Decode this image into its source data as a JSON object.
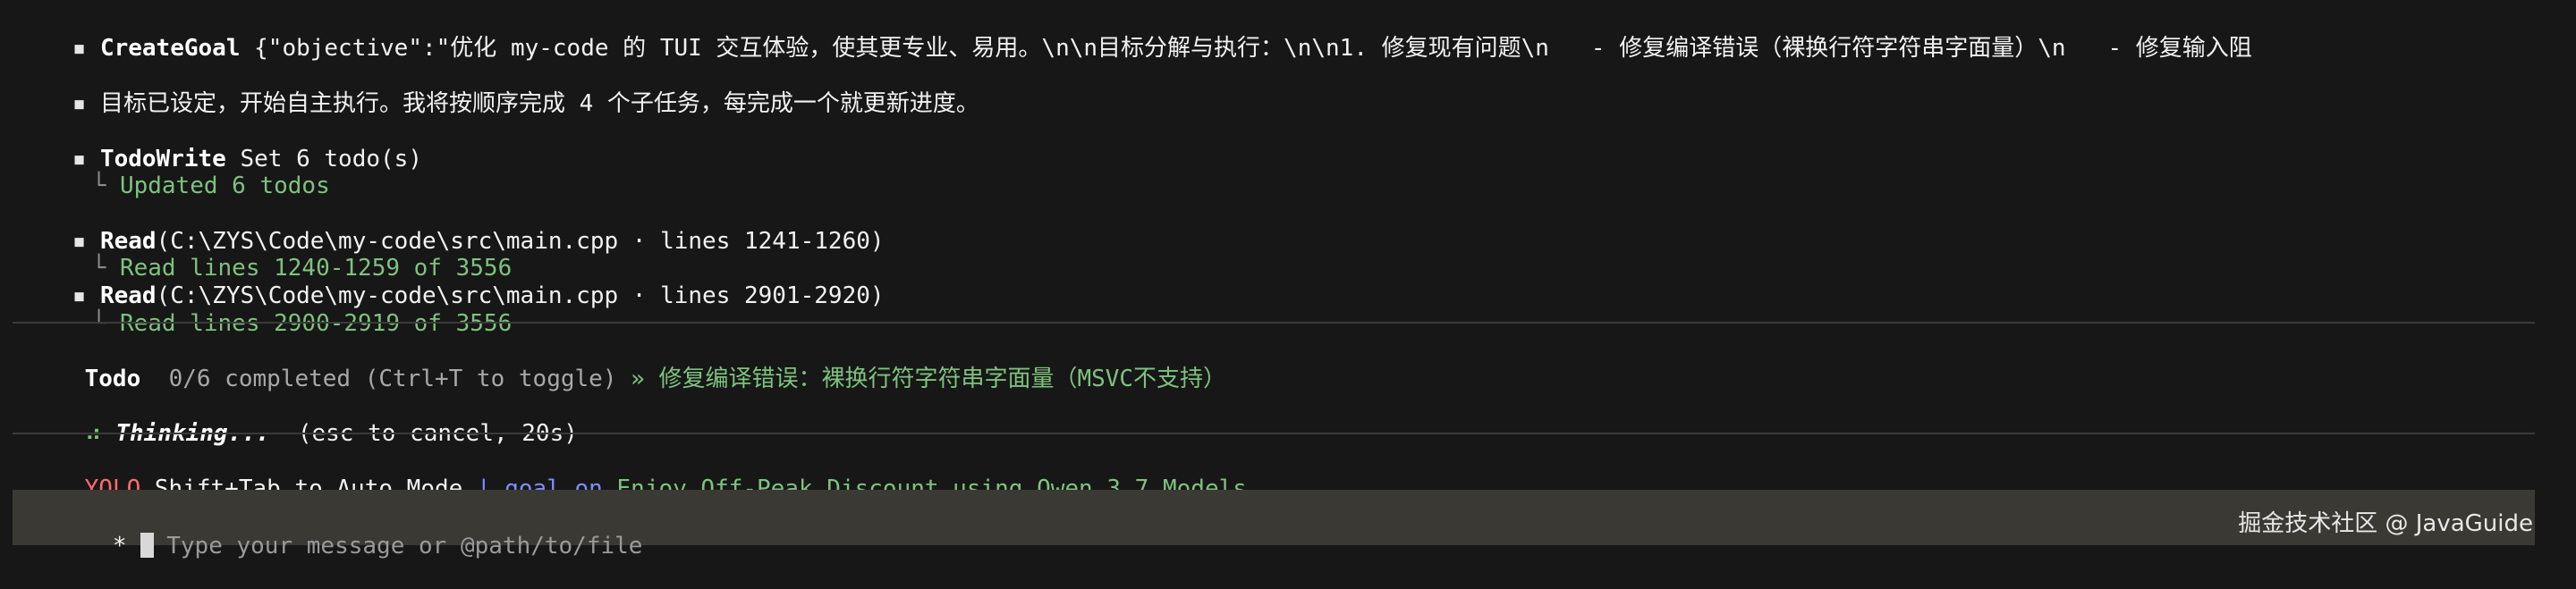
{
  "log": {
    "bullet": "▪",
    "tree_glyph": "└",
    "create_goal": {
      "tool": "CreateGoal",
      "args": "{\"objective\":\"优化 my-code 的 TUI 交互体验，使其更专业、易用。\\n\\n目标分解与执行：\\n\\n1. 修复现有问题\\n   - 修复编译错误（裸换行符字符串字面量）\\n   - 修复输入阻"
    },
    "status_message": "目标已设定，开始自主执行。我将按顺序完成 4 个子任务，每完成一个就更新进度。",
    "todo_write": {
      "tool": "TodoWrite",
      "args": "Set 6 todo(s)",
      "result": "Updated 6 todos"
    },
    "read1": {
      "tool": "Read",
      "args": "(C:\\ZYS\\Code\\my-code\\src\\main.cpp · lines 1241-1260)",
      "result": "Read lines 1240-1259 of 3556"
    },
    "read2": {
      "tool": "Read",
      "args": "(C:\\ZYS\\Code\\my-code\\src\\main.cpp · lines 2901-2920)",
      "result": "Read lines 2900-2919 of 3556"
    }
  },
  "todo_bar": {
    "label": "Todo",
    "progress": "0/6 completed (Ctrl+T to toggle)",
    "separator": "»",
    "current_task": "修复编译错误：裸换行符字符串字面量（MSVC不支持）"
  },
  "thinking": {
    "spinner": "⠴",
    "label": "Thinking...",
    "hint": "(esc to cancel, 20s)"
  },
  "status_bar": {
    "mode": "YOLO",
    "mode_hint": "Shift+Tab to Auto Mode",
    "pipe": "|",
    "goal_label": "goal",
    "goal_state": "on",
    "promo": "Enjoy Off-Peak Discount using Qwen 3.7 Models"
  },
  "input": {
    "prompt": "*",
    "placeholder": "Type your message or @path/to/file"
  },
  "watermark": "掘金技术社区 @ JavaGuide",
  "colors": {
    "background": "#171717",
    "input_bg": "#3b3934",
    "green": "#7ec27e",
    "red": "#ff6b6b",
    "blue": "#7f8cff"
  }
}
